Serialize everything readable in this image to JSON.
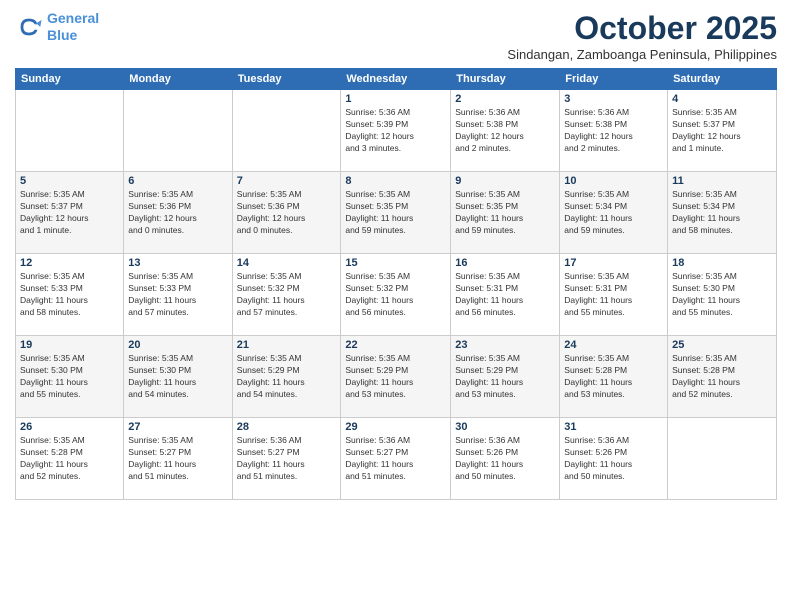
{
  "header": {
    "logo_line1": "General",
    "logo_line2": "Blue",
    "month_title": "October 2025",
    "location": "Sindangan, Zamboanga Peninsula, Philippines"
  },
  "weekdays": [
    "Sunday",
    "Monday",
    "Tuesday",
    "Wednesday",
    "Thursday",
    "Friday",
    "Saturday"
  ],
  "weeks": [
    [
      {
        "day": "",
        "info": ""
      },
      {
        "day": "",
        "info": ""
      },
      {
        "day": "",
        "info": ""
      },
      {
        "day": "1",
        "info": "Sunrise: 5:36 AM\nSunset: 5:39 PM\nDaylight: 12 hours\nand 3 minutes."
      },
      {
        "day": "2",
        "info": "Sunrise: 5:36 AM\nSunset: 5:38 PM\nDaylight: 12 hours\nand 2 minutes."
      },
      {
        "day": "3",
        "info": "Sunrise: 5:36 AM\nSunset: 5:38 PM\nDaylight: 12 hours\nand 2 minutes."
      },
      {
        "day": "4",
        "info": "Sunrise: 5:35 AM\nSunset: 5:37 PM\nDaylight: 12 hours\nand 1 minute."
      }
    ],
    [
      {
        "day": "5",
        "info": "Sunrise: 5:35 AM\nSunset: 5:37 PM\nDaylight: 12 hours\nand 1 minute."
      },
      {
        "day": "6",
        "info": "Sunrise: 5:35 AM\nSunset: 5:36 PM\nDaylight: 12 hours\nand 0 minutes."
      },
      {
        "day": "7",
        "info": "Sunrise: 5:35 AM\nSunset: 5:36 PM\nDaylight: 12 hours\nand 0 minutes."
      },
      {
        "day": "8",
        "info": "Sunrise: 5:35 AM\nSunset: 5:35 PM\nDaylight: 11 hours\nand 59 minutes."
      },
      {
        "day": "9",
        "info": "Sunrise: 5:35 AM\nSunset: 5:35 PM\nDaylight: 11 hours\nand 59 minutes."
      },
      {
        "day": "10",
        "info": "Sunrise: 5:35 AM\nSunset: 5:34 PM\nDaylight: 11 hours\nand 59 minutes."
      },
      {
        "day": "11",
        "info": "Sunrise: 5:35 AM\nSunset: 5:34 PM\nDaylight: 11 hours\nand 58 minutes."
      }
    ],
    [
      {
        "day": "12",
        "info": "Sunrise: 5:35 AM\nSunset: 5:33 PM\nDaylight: 11 hours\nand 58 minutes."
      },
      {
        "day": "13",
        "info": "Sunrise: 5:35 AM\nSunset: 5:33 PM\nDaylight: 11 hours\nand 57 minutes."
      },
      {
        "day": "14",
        "info": "Sunrise: 5:35 AM\nSunset: 5:32 PM\nDaylight: 11 hours\nand 57 minutes."
      },
      {
        "day": "15",
        "info": "Sunrise: 5:35 AM\nSunset: 5:32 PM\nDaylight: 11 hours\nand 56 minutes."
      },
      {
        "day": "16",
        "info": "Sunrise: 5:35 AM\nSunset: 5:31 PM\nDaylight: 11 hours\nand 56 minutes."
      },
      {
        "day": "17",
        "info": "Sunrise: 5:35 AM\nSunset: 5:31 PM\nDaylight: 11 hours\nand 55 minutes."
      },
      {
        "day": "18",
        "info": "Sunrise: 5:35 AM\nSunset: 5:30 PM\nDaylight: 11 hours\nand 55 minutes."
      }
    ],
    [
      {
        "day": "19",
        "info": "Sunrise: 5:35 AM\nSunset: 5:30 PM\nDaylight: 11 hours\nand 55 minutes."
      },
      {
        "day": "20",
        "info": "Sunrise: 5:35 AM\nSunset: 5:30 PM\nDaylight: 11 hours\nand 54 minutes."
      },
      {
        "day": "21",
        "info": "Sunrise: 5:35 AM\nSunset: 5:29 PM\nDaylight: 11 hours\nand 54 minutes."
      },
      {
        "day": "22",
        "info": "Sunrise: 5:35 AM\nSunset: 5:29 PM\nDaylight: 11 hours\nand 53 minutes."
      },
      {
        "day": "23",
        "info": "Sunrise: 5:35 AM\nSunset: 5:29 PM\nDaylight: 11 hours\nand 53 minutes."
      },
      {
        "day": "24",
        "info": "Sunrise: 5:35 AM\nSunset: 5:28 PM\nDaylight: 11 hours\nand 53 minutes."
      },
      {
        "day": "25",
        "info": "Sunrise: 5:35 AM\nSunset: 5:28 PM\nDaylight: 11 hours\nand 52 minutes."
      }
    ],
    [
      {
        "day": "26",
        "info": "Sunrise: 5:35 AM\nSunset: 5:28 PM\nDaylight: 11 hours\nand 52 minutes."
      },
      {
        "day": "27",
        "info": "Sunrise: 5:35 AM\nSunset: 5:27 PM\nDaylight: 11 hours\nand 51 minutes."
      },
      {
        "day": "28",
        "info": "Sunrise: 5:36 AM\nSunset: 5:27 PM\nDaylight: 11 hours\nand 51 minutes."
      },
      {
        "day": "29",
        "info": "Sunrise: 5:36 AM\nSunset: 5:27 PM\nDaylight: 11 hours\nand 51 minutes."
      },
      {
        "day": "30",
        "info": "Sunrise: 5:36 AM\nSunset: 5:26 PM\nDaylight: 11 hours\nand 50 minutes."
      },
      {
        "day": "31",
        "info": "Sunrise: 5:36 AM\nSunset: 5:26 PM\nDaylight: 11 hours\nand 50 minutes."
      },
      {
        "day": "",
        "info": ""
      }
    ]
  ]
}
